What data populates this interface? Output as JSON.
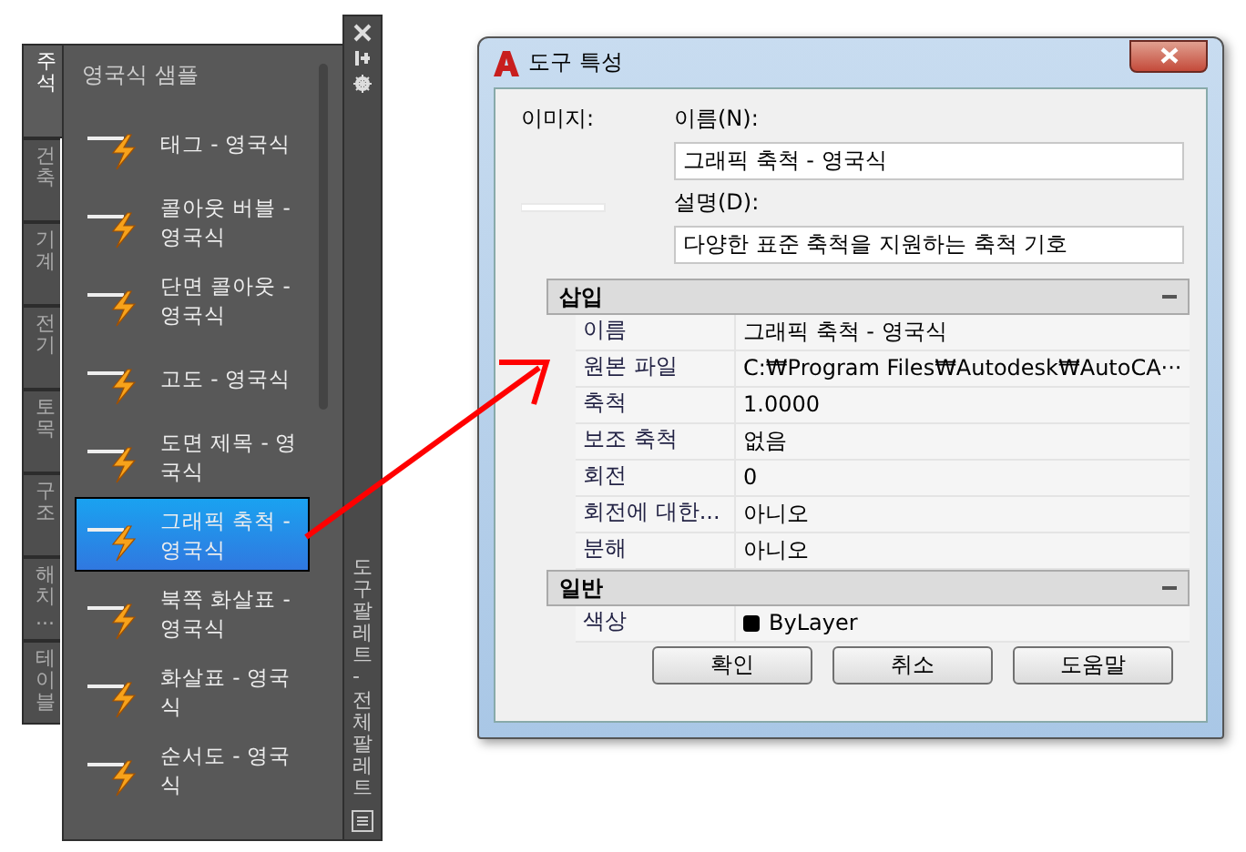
{
  "palette": {
    "title": "영국식 샘플",
    "side_title": "도구 팔레트 - 전체 팔레트",
    "tabs": [
      {
        "label": "주석",
        "selected": true
      },
      {
        "label": "건축",
        "selected": false
      },
      {
        "label": "기계",
        "selected": false
      },
      {
        "label": "전기",
        "selected": false
      },
      {
        "label": "토목",
        "selected": false
      },
      {
        "label": "구조",
        "selected": false
      },
      {
        "label": "해치...",
        "selected": false
      },
      {
        "label": "테이블",
        "selected": false
      }
    ],
    "items": [
      {
        "label": "태그 - 영국식",
        "selected": false
      },
      {
        "label": "콜아웃 버블 - 영국식",
        "selected": false
      },
      {
        "label": "단면 콜아웃 - 영국식",
        "selected": false
      },
      {
        "label": "고도 - 영국식",
        "selected": false
      },
      {
        "label": "도면 제목 - 영국식",
        "selected": false
      },
      {
        "label": "그래픽 축척 - 영국식",
        "selected": true
      },
      {
        "label": "북쪽 화살표 - 영국식",
        "selected": false
      },
      {
        "label": "화살표 - 영국식",
        "selected": false
      },
      {
        "label": "순서도 - 영국식",
        "selected": false
      }
    ]
  },
  "dialog": {
    "title": "도구 특성",
    "image_label": "이미지:",
    "name_label": "이름(N):",
    "name_value": "그래픽 축척 - 영국식",
    "description_label": "설명(D):",
    "description_value": "다양한 표준 축척을 지원하는 축척 기호",
    "sections": [
      {
        "title": "삽입",
        "expanded": true,
        "rows": [
          {
            "kind": "text",
            "name": "이름",
            "value": "그래픽 축척 - 영국식"
          },
          {
            "kind": "text",
            "name": "원본 파일",
            "value": "C:₩Program  Files₩Autodesk₩AutoCA···"
          },
          {
            "kind": "text",
            "name": "축척",
            "value": "1.0000"
          },
          {
            "kind": "text",
            "name": "보조 축척",
            "value": "없음"
          },
          {
            "kind": "text",
            "name": "회전",
            "value": "0"
          },
          {
            "kind": "text",
            "name": "회전에 대한...",
            "value": "아니오"
          },
          {
            "kind": "text",
            "name": "분해",
            "value": "아니오"
          }
        ]
      },
      {
        "title": "일반",
        "expanded": true,
        "rows": [
          {
            "kind": "color",
            "name": "색상",
            "value": "ByLayer",
            "color": "#000000"
          }
        ]
      }
    ],
    "buttons": [
      "확인",
      "취소",
      "도움말"
    ]
  }
}
